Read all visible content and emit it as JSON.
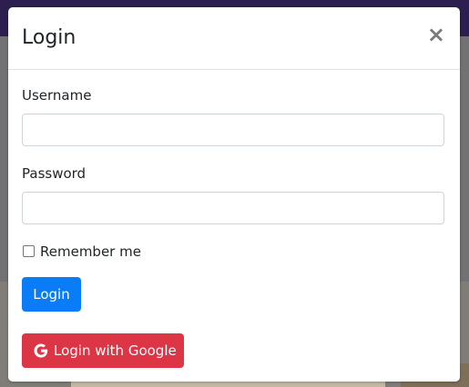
{
  "modal": {
    "title": "Login",
    "close_symbol": "×",
    "username_label": "Username",
    "username_value": "",
    "password_label": "Password",
    "password_value": "",
    "remember_label": "Remember me",
    "remember_checked": false,
    "login_button": "Login",
    "google_button": "Login with Google",
    "google_icon": "google-icon"
  },
  "colors": {
    "primary": "#0a7cf7",
    "danger": "#dc3545",
    "header_bg": "#2c1f4f"
  }
}
